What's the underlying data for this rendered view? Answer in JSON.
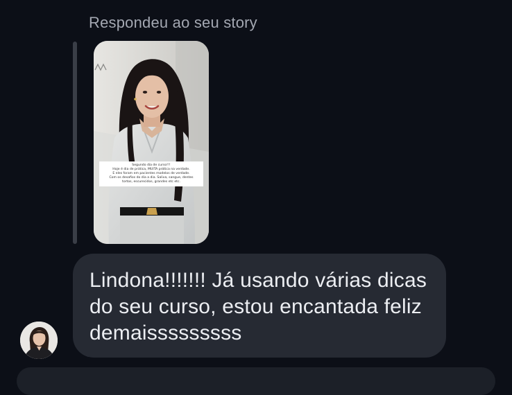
{
  "thread": {
    "reply_context_label": "Respondeu ao seu story"
  },
  "story": {
    "caption_lines": [
      "Segundo dia de curso!!!",
      "Hoje é dia de prática, MUITA prática na verdade.",
      "E eles foram em pacientes modelos de verdade.",
      "Com os desafios do dia a dia. Saliva, sangue, dentes",
      "tortos, escurecidos, grandes etc etc."
    ]
  },
  "message": {
    "lines": [
      "Lindona!!!!!!! Já usando várias dicas",
      "do seu curso, estou encantada feliz",
      "demaisssssssss"
    ]
  },
  "colors": {
    "background": "#0c0f17",
    "bubble": "#262a33",
    "message_text": "#eceef2",
    "label_text": "#a4a8b2",
    "reply_bar": "#3a3e47"
  }
}
